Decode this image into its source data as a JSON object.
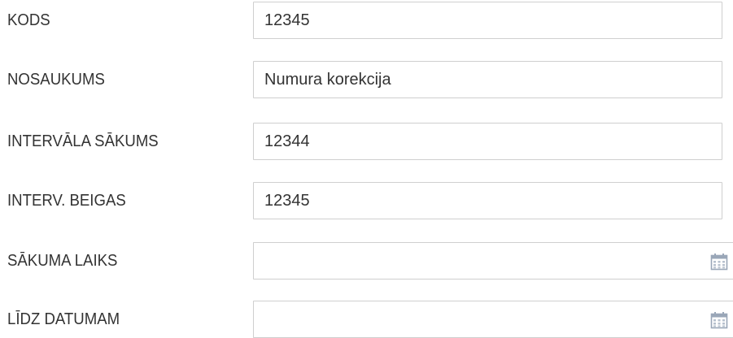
{
  "form": {
    "fields": [
      {
        "label": "KODS",
        "value": "12345"
      },
      {
        "label": "NOSAUKUMS",
        "value": "Numura korekcija"
      },
      {
        "label": "INTERVĀLA SĀKUMS",
        "value": "12344"
      },
      {
        "label": "INTERV. BEIGAS",
        "value": "12345"
      },
      {
        "label": "SĀKUMA LAIKS",
        "value": "",
        "icon": "calendar-icon"
      },
      {
        "label": "LĪDZ DATUMAM",
        "value": "",
        "icon": "calendar-icon"
      }
    ]
  },
  "colors": {
    "label_text": "#333333",
    "input_border": "#cfcfcf",
    "calendar_icon": "#9aa7b8"
  }
}
